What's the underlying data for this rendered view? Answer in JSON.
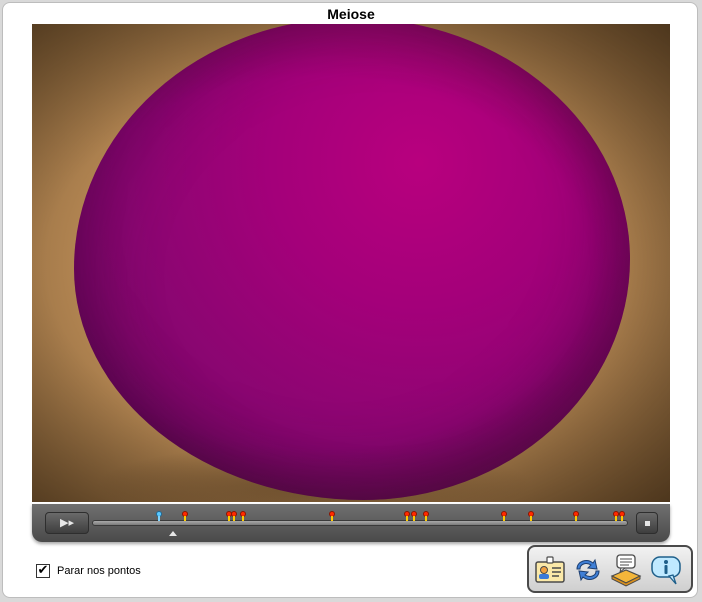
{
  "window": {
    "title": "Meiose"
  },
  "player": {
    "play_label": "▶▸",
    "stop_label": "■",
    "markers": [
      {
        "id": "m1",
        "state": "current"
      },
      {
        "id": "m2",
        "state": "normal"
      },
      {
        "id": "m3",
        "state": "normal"
      },
      {
        "id": "m4",
        "state": "normal"
      },
      {
        "id": "m5",
        "state": "normal"
      },
      {
        "id": "m6",
        "state": "normal"
      },
      {
        "id": "m7",
        "state": "normal"
      },
      {
        "id": "m8",
        "state": "normal"
      },
      {
        "id": "m9",
        "state": "normal"
      },
      {
        "id": "m10",
        "state": "normal"
      },
      {
        "id": "m11",
        "state": "normal"
      },
      {
        "id": "m12",
        "state": "normal"
      },
      {
        "id": "m13",
        "state": "normal"
      },
      {
        "id": "m14",
        "state": "normal"
      }
    ]
  },
  "options": {
    "stop_at_points_label": "Parar nos pontos",
    "stop_at_points_checked": "✔"
  },
  "toolbar": {
    "icons": [
      "id-card-icon",
      "refresh-arrows-icon",
      "book-comment-icon",
      "info-bubble-icon"
    ]
  },
  "colors": {
    "cell": "#a4007a",
    "background": "#c99a62",
    "marker": "#ff2a00",
    "current_marker": "#5ac8ff"
  }
}
